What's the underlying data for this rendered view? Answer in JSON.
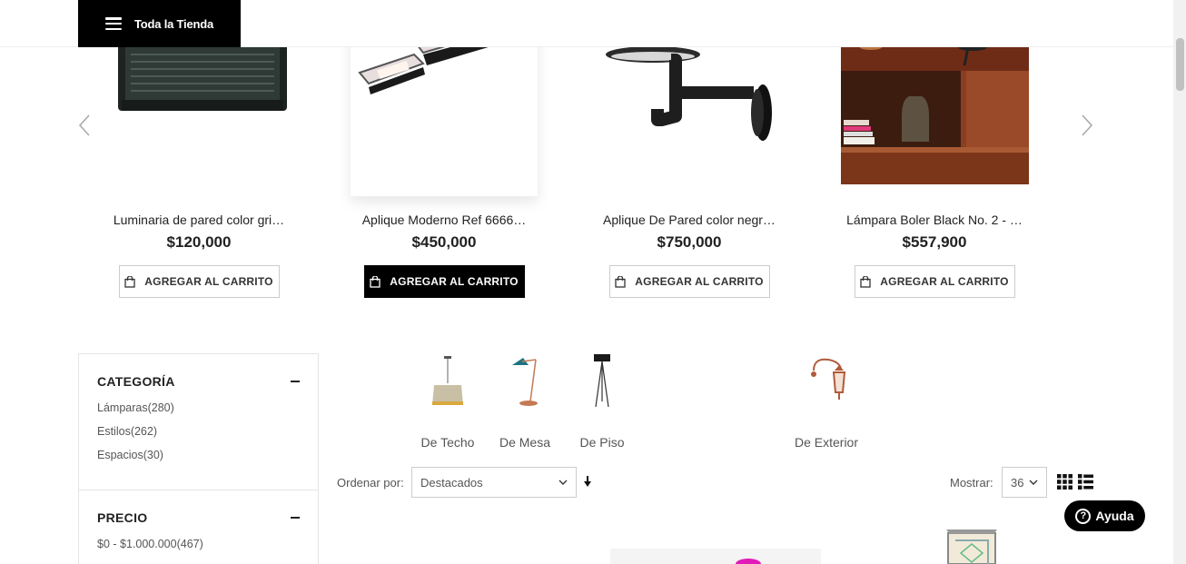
{
  "header": {
    "menu_label": "Toda la Tienda"
  },
  "carousel": {
    "products": [
      {
        "title": "Luminaria de pared color gri…",
        "price": "$120,000",
        "button": "AGREGAR AL CARRITO",
        "active": false
      },
      {
        "title": "Aplique Moderno Ref 6666…",
        "price": "$450,000",
        "button": "AGREGAR AL CARRITO",
        "active": true
      },
      {
        "title": "Aplique De Pared color negr…",
        "price": "$750,000",
        "button": "AGREGAR AL CARRITO",
        "active": false
      },
      {
        "title": "Lámpara Boler Black No. 2 - …",
        "price": "$557,900",
        "button": "AGREGAR AL CARRITO",
        "active": false
      }
    ]
  },
  "filters": {
    "category": {
      "title": "CATEGORÍA",
      "items": [
        "Lámparas(280)",
        "Estilos(262)",
        "Espacios(30)"
      ]
    },
    "price": {
      "title": "PRECIO",
      "items": [
        "$0 - $1.000.000(467)"
      ]
    }
  },
  "categories": [
    {
      "label": "De Techo",
      "icon": "pendant-lamp-icon"
    },
    {
      "label": "De Mesa",
      "icon": "desk-lamp-icon"
    },
    {
      "label": "De Piso",
      "icon": "floor-lamp-icon"
    },
    {
      "label": "De Exterior",
      "icon": "outdoor-lantern-icon"
    }
  ],
  "toolbar": {
    "sort_label": "Ordenar por:",
    "sort_value": "Destacados",
    "show_label": "Mostrar:",
    "show_value": "36"
  },
  "help": {
    "label": "Ayuda"
  },
  "colors": {
    "black": "#000000",
    "border": "#cccccc",
    "text": "#333333"
  }
}
